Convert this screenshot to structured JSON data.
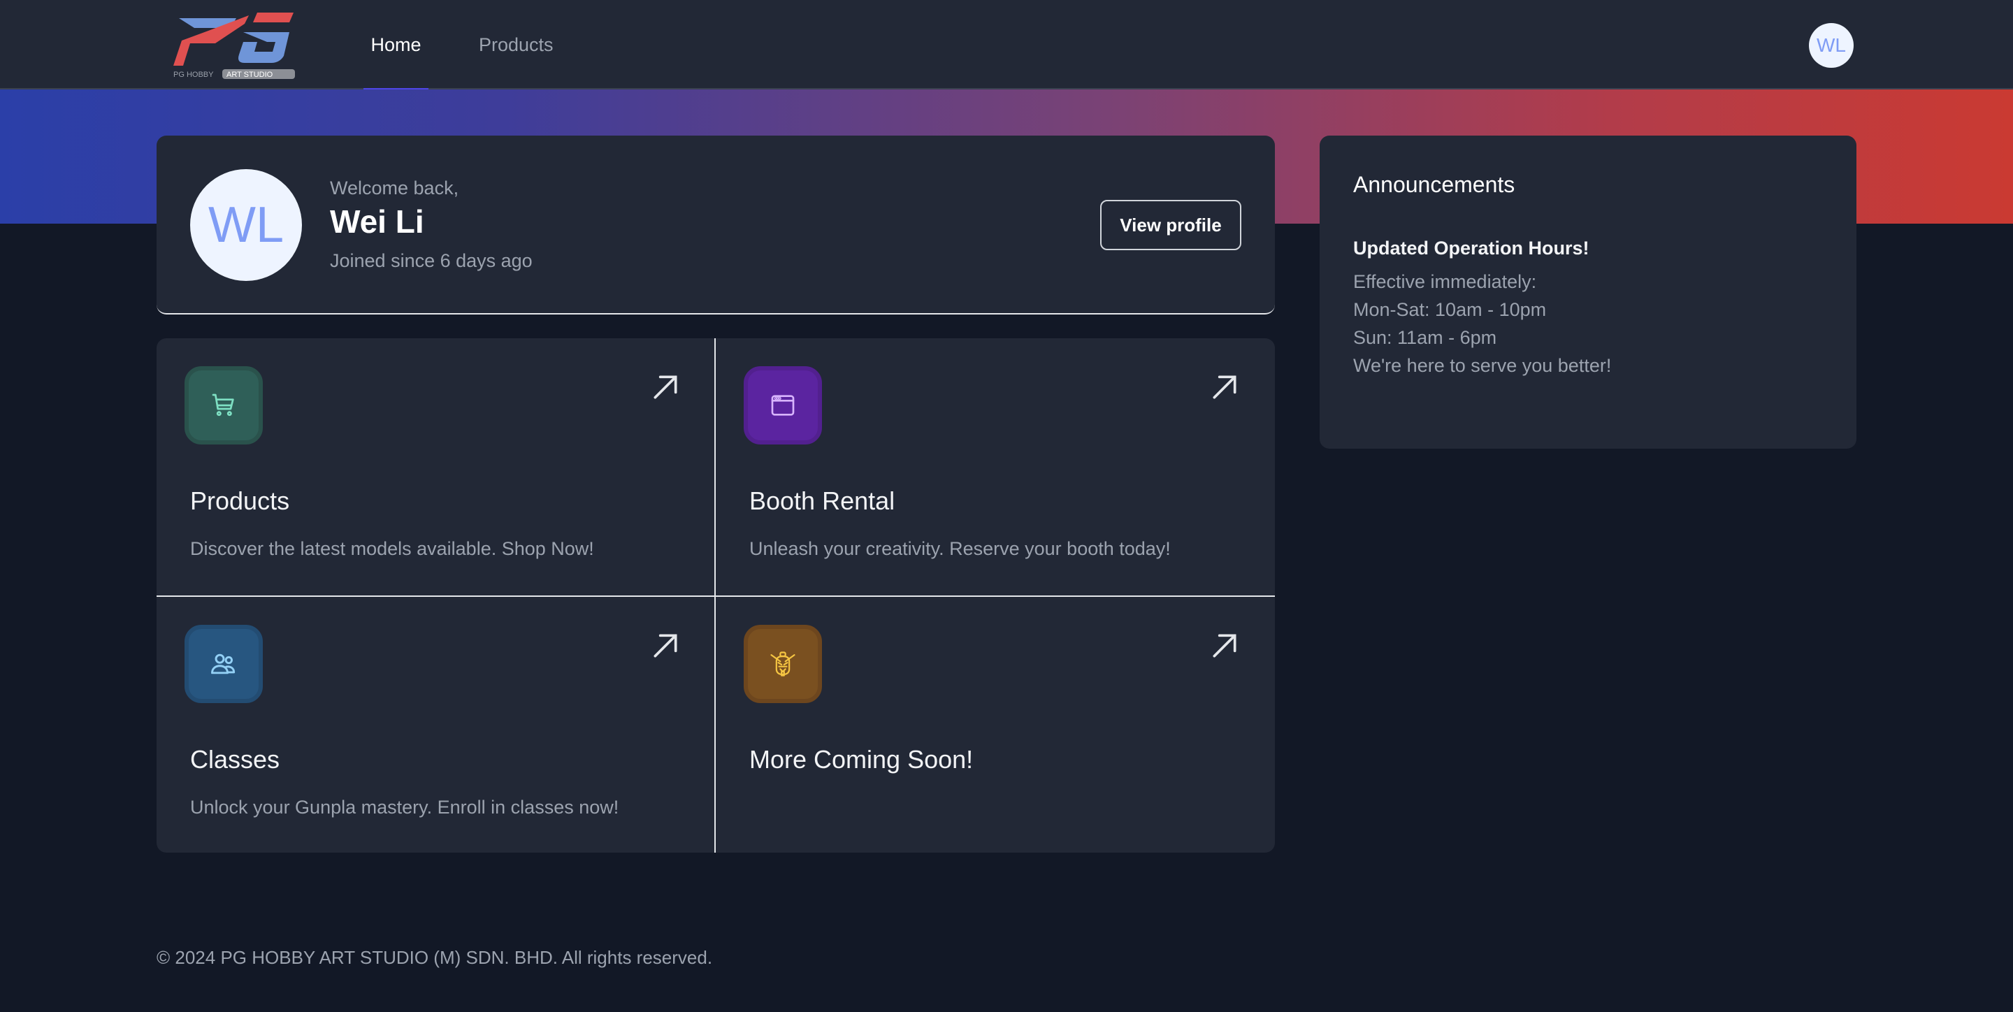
{
  "header": {
    "logo": {
      "main": "PG",
      "sub_left": "PG HOBBY",
      "sub_right": "ART STUDIO"
    },
    "nav": [
      {
        "label": "Home",
        "active": true
      },
      {
        "label": "Products",
        "active": false
      }
    ],
    "avatar_initials": "WL"
  },
  "colors": {
    "header_bg": "#222836",
    "page_bg": "#121826",
    "card_bg": "#222836",
    "accent": "#4f46e5",
    "gradient_start": "#2b3fa8",
    "gradient_end": "#ca3a32",
    "avatar_bg": "#eef4ff",
    "avatar_text": "#7f9cf5"
  },
  "welcome": {
    "avatar_initials": "WL",
    "greeting": "Welcome back,",
    "name": "Wei Li",
    "joined": "Joined since 6 days ago",
    "view_profile_label": "View profile"
  },
  "tiles": [
    {
      "icon": "shopping-cart-icon",
      "title": "Products",
      "description": "Discover the latest models available. Shop Now!",
      "icon_bg": "#2f5f58",
      "icon_color": "#7ee0c3"
    },
    {
      "icon": "browser-window-icon",
      "title": "Booth Rental",
      "description": "Unleash your creativity. Reserve your booth today!",
      "icon_bg": "#5b24a0",
      "icon_color": "#d8b4fe"
    },
    {
      "icon": "users-icon",
      "title": "Classes",
      "description": "Unlock your Gunpla mastery. Enroll in classes now!",
      "icon_bg": "#275680",
      "icon_color": "#93d0f5"
    },
    {
      "icon": "gundam-head-icon",
      "title": "More Coming Soon!",
      "description": "",
      "icon_bg": "#7a5020",
      "icon_color": "#f5c542"
    }
  ],
  "announcements": {
    "heading": "Announcements",
    "title": "Updated Operation Hours!",
    "lines": [
      "Effective immediately:",
      "Mon-Sat: 10am - 10pm",
      "Sun: 11am - 6pm",
      "We're here to serve you better!"
    ]
  },
  "footer": {
    "copyright": "© 2024 PG HOBBY ART STUDIO (M) SDN. BHD. All rights reserved."
  }
}
